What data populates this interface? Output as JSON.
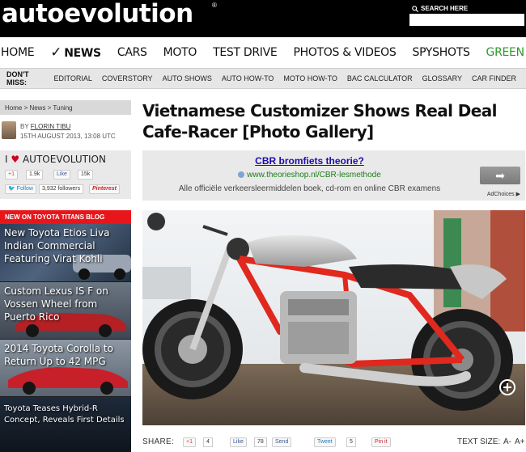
{
  "header": {
    "logo": "autoevolution",
    "reg": "®",
    "search_label": "SEARCH HERE",
    "search_placeholder": ""
  },
  "nav": {
    "items": [
      {
        "label": "HOME"
      },
      {
        "label": "NEWS",
        "active": true
      },
      {
        "label": "CARS"
      },
      {
        "label": "MOTO"
      },
      {
        "label": "TEST DRIVE"
      },
      {
        "label": "PHOTOS & VIDEOS"
      },
      {
        "label": "SPYSHOTS"
      },
      {
        "label": "GREEN",
        "color": "#2d9a2d"
      }
    ],
    "check": "✓"
  },
  "subnav": {
    "dont_miss": "DON'T MISS:",
    "items": [
      "EDITORIAL",
      "COVERSTORY",
      "AUTO SHOWS",
      "AUTO HOW-TO",
      "MOTO HOW-TO",
      "BAC CALCULATOR",
      "GLOSSARY",
      "CAR FINDER"
    ]
  },
  "breadcrumb": "Home > News > Tuning",
  "author": {
    "by": "BY",
    "name": "FLORIN TIBU",
    "date": "15TH AUGUST 2013, 13:08 UTC"
  },
  "social": {
    "love_prefix": "I",
    "heart": "♥",
    "love_brand": "AUTOEVOLUTION",
    "gplus": "+1",
    "gplus_count": "1.9k",
    "like": "Like",
    "like_count": "15k",
    "follow": "Follow",
    "followers": "3,932 followers",
    "pinterest": "Pinterest"
  },
  "blog": {
    "header": "NEW ON TOYOTA TITANS BLOG",
    "items": [
      {
        "title": "New Toyota Etios Liva Indian Commercial Featuring Virat Kohli"
      },
      {
        "title": "Custom Lexus IS F on Vossen Wheel from Puerto Rico"
      },
      {
        "title": "2014 Toyota Corolla to Return Up to 42 MPG"
      },
      {
        "title": "Toyota Teases Hybrid-R Concept, Reveals First Details"
      }
    ]
  },
  "article": {
    "title": "Vietnamese Customizer Shows Real Deal Cafe-Racer [Photo Gallery]"
  },
  "ad": {
    "title": "CBR bromfiets theorie?",
    "url": "www.theorieshop.nl/CBR-lesmethode",
    "description": "Alle officiële verkeersleermiddelen boek, cd-rom en online CBR examens",
    "arrow": "➡",
    "adchoices": "AdChoices ▶"
  },
  "share": {
    "label": "SHARE:",
    "gplus": "+1",
    "gplus_count": "4",
    "like": "Like",
    "like_count": "78",
    "send": "Send",
    "tweet": "Tweet",
    "tweet_count": "5",
    "pin": "Pin it",
    "textsize_label": "TEXT SIZE:",
    "a_minus": "A-",
    "a_plus": "A+"
  },
  "colors": {
    "header_bg": "#000000",
    "accent_red": "#e8161b",
    "green": "#2d9a2d",
    "frame_red": "#e0281e"
  }
}
